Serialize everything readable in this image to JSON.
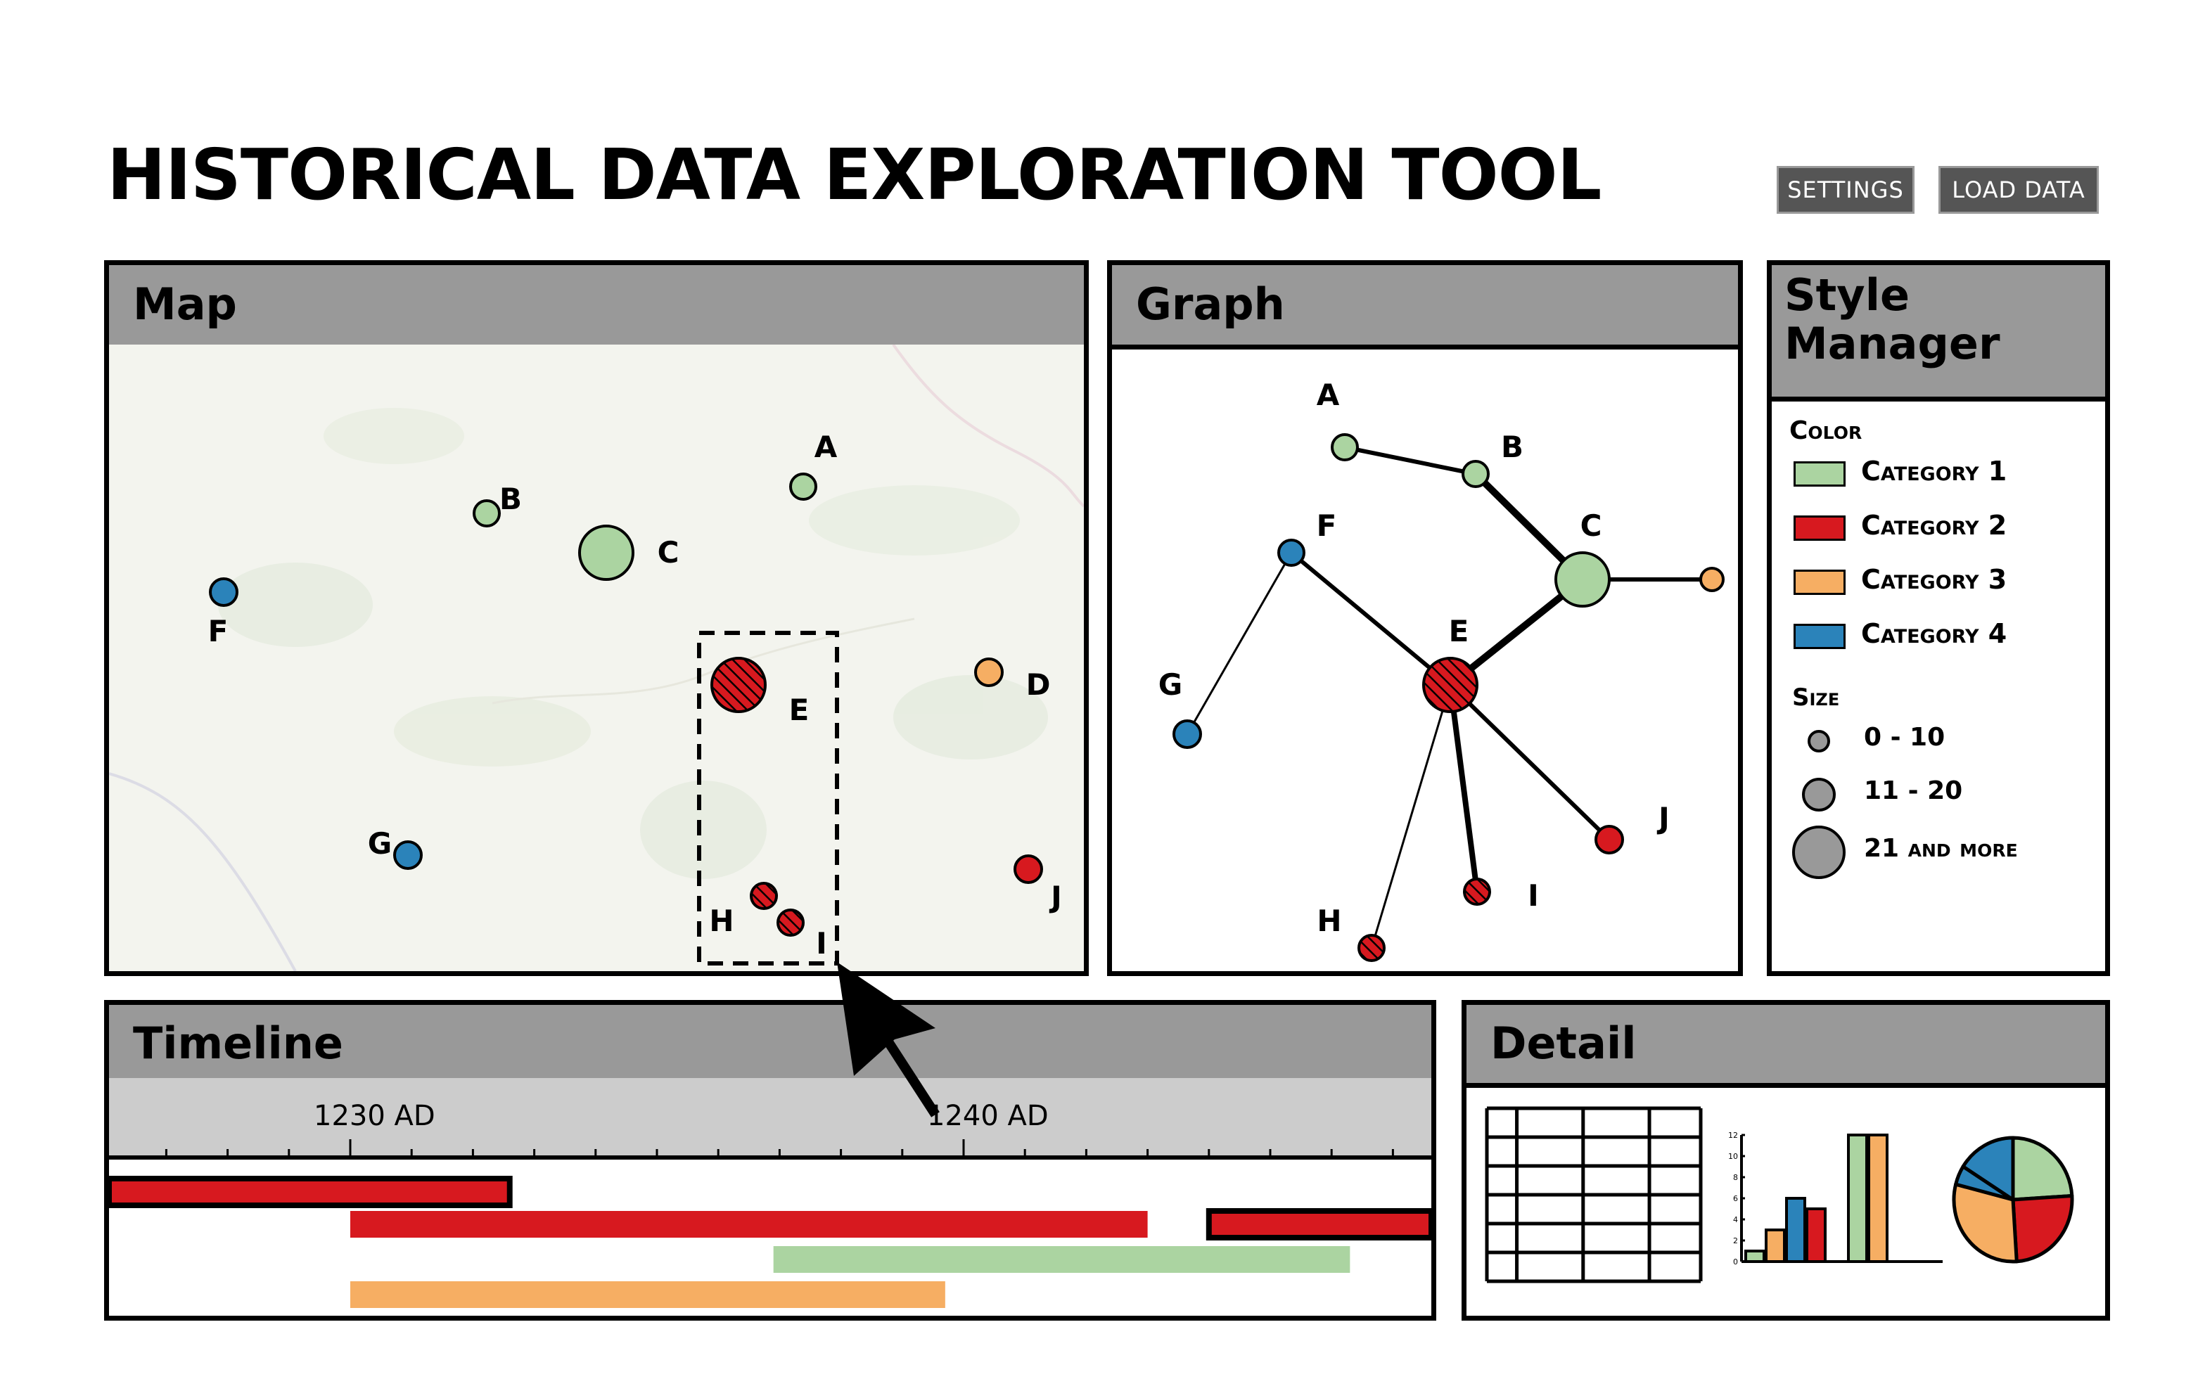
{
  "header": {
    "title": "HISTORICAL DATA EXPLORATION TOOL",
    "settings_label": "SETTINGS",
    "load_data_label": "LOAD DATA"
  },
  "colors": {
    "category_1": "#abd4a1",
    "category_2": "#d7191f",
    "category_3": "#f6ae63",
    "category_4": "#2b83ba",
    "panel_header": "#999999",
    "timeline_axis": "#cccccc"
  },
  "map": {
    "title": "Map",
    "points": [
      {
        "label": "A",
        "category": 1,
        "size": "0 - 10"
      },
      {
        "label": "B",
        "category": 1,
        "size": "0 - 10"
      },
      {
        "label": "C",
        "category": 1,
        "size": "21 and more"
      },
      {
        "label": "D",
        "category": 3,
        "size": "0 - 10"
      },
      {
        "label": "E",
        "category": 2,
        "size": "21 and more",
        "selected": true
      },
      {
        "label": "F",
        "category": 4,
        "size": "0 - 10"
      },
      {
        "label": "G",
        "category": 4,
        "size": "0 - 10"
      },
      {
        "label": "H",
        "category": 2,
        "size": "0 - 10",
        "selected": true
      },
      {
        "label": "I",
        "category": 2,
        "size": "0 - 10",
        "selected": true
      },
      {
        "label": "J",
        "category": 2,
        "size": "0 - 10"
      }
    ]
  },
  "graph": {
    "title": "Graph",
    "nodes": [
      "A",
      "B",
      "C",
      "E",
      "F",
      "G",
      "H",
      "I",
      "J"
    ]
  },
  "style_manager": {
    "title_line1": "Style",
    "title_line2": "Manager",
    "color_heading": "Color",
    "categories": [
      "Category 1",
      "Category 2",
      "Category 3",
      "Category 4"
    ],
    "size_heading": "Size",
    "sizes": [
      "0 - 10",
      "11 - 20",
      "21 and more"
    ]
  },
  "timeline": {
    "title": "Timeline",
    "tick_labels": [
      "1230 AD",
      "1240 AD"
    ],
    "bars": [
      {
        "category": 2,
        "start": 1226,
        "end": 1232.6,
        "selected": true
      },
      {
        "category": 2,
        "start": 1230,
        "end": 1243,
        "selected": false
      },
      {
        "category": 2,
        "start": 1244,
        "end": 1247.7,
        "selected": true
      },
      {
        "category": 1,
        "start": 1236.9,
        "end": 1246.3,
        "selected": false
      },
      {
        "category": 3,
        "start": 1230,
        "end": 1239.7,
        "selected": false
      }
    ]
  },
  "detail": {
    "title": "Detail",
    "table": {
      "rows": 6,
      "cols": 4
    },
    "chart_data": [
      {
        "type": "bar",
        "yticks": [
          "0",
          "2",
          "4",
          "6",
          "8",
          "10",
          "12"
        ],
        "ylim": [
          0,
          12
        ],
        "groups": [
          {
            "values": [
              1,
              3,
              6,
              5
            ],
            "categories": [
              1,
              3,
              4,
              2
            ]
          },
          {
            "values": [
              12,
              12
            ],
            "categories": [
              1,
              3
            ]
          }
        ]
      },
      {
        "type": "pie",
        "values": [
          24,
          25,
          30,
          5,
          16
        ],
        "categories": [
          1,
          2,
          3,
          4,
          4
        ]
      }
    ]
  }
}
